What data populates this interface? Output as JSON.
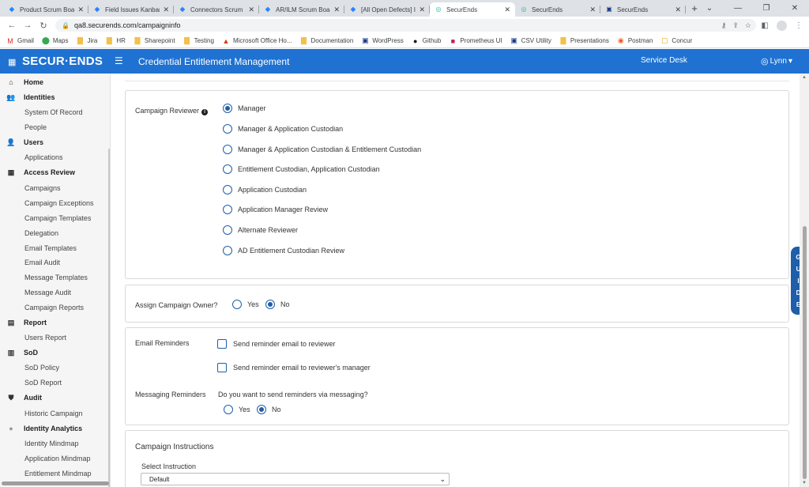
{
  "browser": {
    "tabs": [
      {
        "title": "Product Scrum Board",
        "icon": "jira-icon"
      },
      {
        "title": "Field Issues Kanban B",
        "icon": "jira-icon"
      },
      {
        "title": "Connectors Scrum B",
        "icon": "jira-icon"
      },
      {
        "title": "AR/ILM Scrum Board",
        "icon": "jira-icon"
      },
      {
        "title": "[All Open Defects] In",
        "icon": "jira-icon"
      },
      {
        "title": "SecurEnds",
        "icon": "securends-icon",
        "active": true
      },
      {
        "title": "SecurEnds",
        "icon": "securends-icon"
      },
      {
        "title": "SecurEnds",
        "icon": "generic-page-icon"
      }
    ],
    "url": "qa8.securends.com/campaigninfo",
    "bookmarks": [
      "Gmail",
      "Maps",
      "Jira",
      "HR",
      "Sharepoint",
      "Testing",
      "Microsoft Office Ho...",
      "Documentation",
      "WordPress",
      "Github",
      "Prometheus UI",
      "CSV Utility",
      "Presentations",
      "Postman",
      "Concur"
    ]
  },
  "header": {
    "logo": "SECUR·ENDS",
    "title": "Credential Entitlement Management",
    "service_desk": "Service Desk",
    "user": "Lynn",
    "brand_color": "#1f72d2"
  },
  "sidebar": {
    "items": [
      {
        "label": "Home",
        "section": true,
        "icon": "home-icon"
      },
      {
        "label": "Identities",
        "section": true,
        "icon": "people-icon"
      },
      {
        "label": "System Of Record"
      },
      {
        "label": "People"
      },
      {
        "label": "Users",
        "section": true,
        "icon": "user-icon"
      },
      {
        "label": "Applications"
      },
      {
        "label": "Access Review",
        "section": true,
        "icon": "grid-icon"
      },
      {
        "label": "Campaigns"
      },
      {
        "label": "Campaign Exceptions"
      },
      {
        "label": "Campaign Templates"
      },
      {
        "label": "Delegation"
      },
      {
        "label": "Email Templates"
      },
      {
        "label": "Email Audit"
      },
      {
        "label": "Message Templates"
      },
      {
        "label": "Message Audit"
      },
      {
        "label": "Campaign Reports"
      },
      {
        "label": "Report",
        "section": true,
        "icon": "report-icon"
      },
      {
        "label": "Users Report"
      },
      {
        "label": "SoD",
        "section": true,
        "icon": "sod-icon"
      },
      {
        "label": "SoD Policy"
      },
      {
        "label": "SoD Report"
      },
      {
        "label": "Audit",
        "section": true,
        "icon": "shield-icon"
      },
      {
        "label": "Historic Campaign"
      },
      {
        "label": "Identity Analytics",
        "section": true,
        "icon": "analytics-icon"
      },
      {
        "label": "Identity Mindmap"
      },
      {
        "label": "Application Mindmap"
      },
      {
        "label": "Entitlement Mindmap"
      }
    ]
  },
  "main": {
    "reviewer": {
      "label": "Campaign Reviewer",
      "options": [
        {
          "label": "Manager",
          "checked": true
        },
        {
          "label": "Manager & Application Custodian"
        },
        {
          "label": "Manager & Application Custodian & Entitlement Custodian"
        },
        {
          "label": "Entitlement Custodian, Application Custodian"
        },
        {
          "label": "Application Custodian"
        },
        {
          "label": "Application Manager Review"
        },
        {
          "label": "Alternate Reviewer"
        },
        {
          "label": "AD Entitlement Custodian Review"
        }
      ]
    },
    "owner": {
      "label": "Assign Campaign Owner?",
      "yes": "Yes",
      "no": "No",
      "selected": "No"
    },
    "reminders": {
      "email_label": "Email Reminders",
      "email_options": [
        "Send reminder email to reviewer",
        "Send reminder email to reviewer's manager"
      ],
      "messaging_label": "Messaging Reminders",
      "messaging_question": "Do you want to send reminders via messaging?",
      "yes": "Yes",
      "no": "No",
      "selected": "No"
    },
    "instructions": {
      "title": "Campaign Instructions",
      "select_label": "Select Instruction",
      "selected": "Default"
    }
  },
  "guide": [
    "G",
    "U",
    "I",
    "D",
    "E"
  ]
}
